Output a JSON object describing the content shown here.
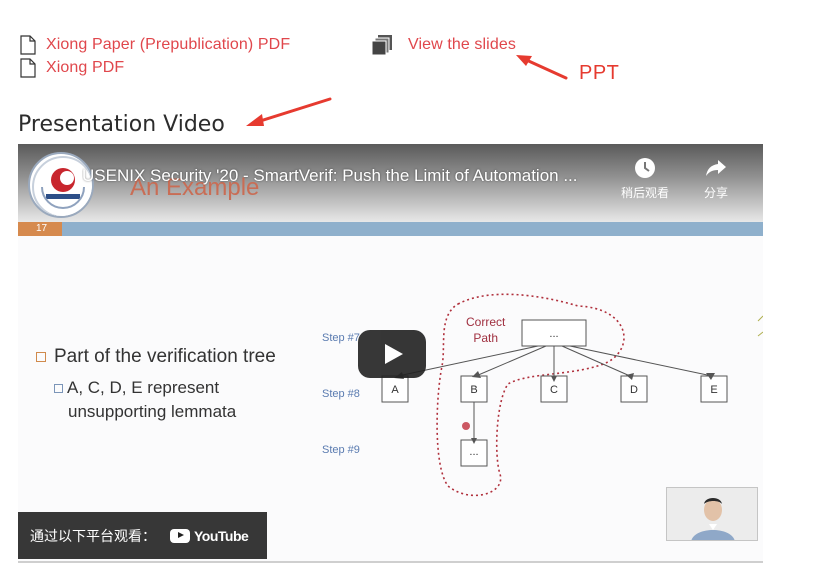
{
  "links": {
    "paper_prepub": "Xiong Paper (Prepublication) PDF",
    "paper_pdf": "Xiong PDF",
    "slides": "View the slides"
  },
  "annotation": {
    "ppt_label": "PPT",
    "color": "#e63a2f"
  },
  "section": {
    "heading": "Presentation Video"
  },
  "video": {
    "title": "USENIX Security '20 - SmartVerif: Push the Limit of Automation ...",
    "watch_later": "稍后观看",
    "share": "分享",
    "watch_on": "通过以下平台观看：",
    "youtube": "YouTube",
    "slide": {
      "title": "An Example",
      "number": "17",
      "bullet_main": "Part of the verification tree",
      "bullet_sub_line1": "A, C, D, E represent",
      "bullet_sub_line2": "unsupporting lemmata",
      "correct_path_line1": "Correct",
      "correct_path_line2": "Path",
      "root_node": "...",
      "leaf_node": "...",
      "steps": [
        "Step #7",
        "Step #8",
        "Step #9"
      ],
      "nodes": [
        "A",
        "B",
        "C",
        "D",
        "E"
      ]
    }
  },
  "colors": {
    "link": "#e0474c",
    "heading": "#2c2c2c",
    "youtube_overlay": "#212121"
  },
  "icons": {
    "doc": "document-icon",
    "slides": "stacked-pages-icon",
    "watch_later": "clock-icon",
    "share": "share-arrow-icon",
    "play": "play-icon"
  }
}
